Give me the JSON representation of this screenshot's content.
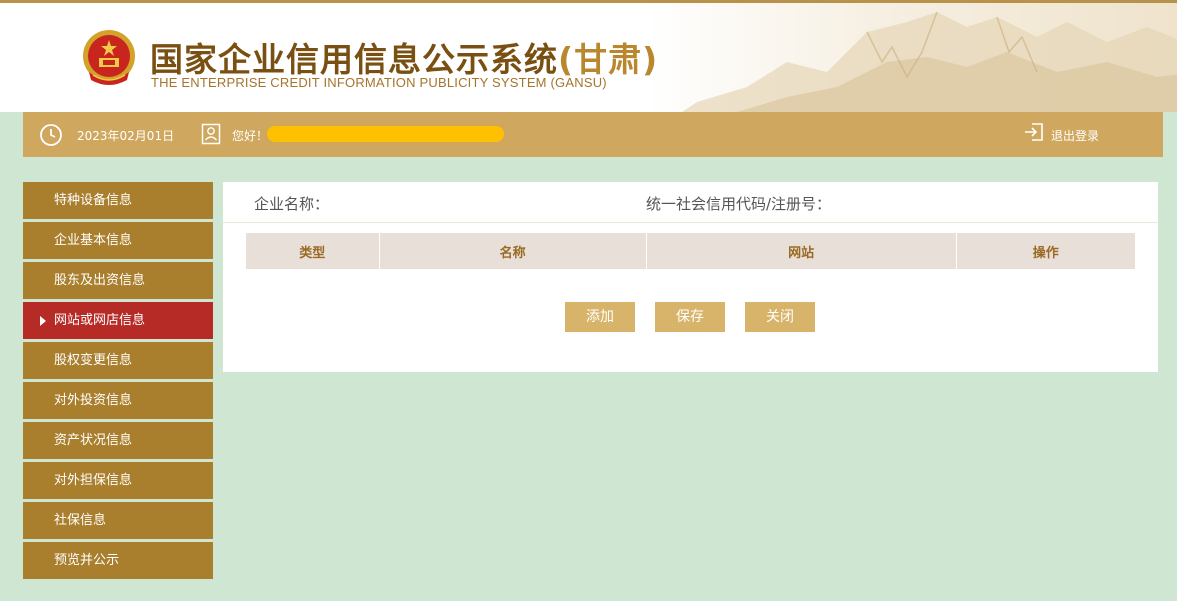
{
  "header": {
    "title_cn": "国家企业信用信息公示系统",
    "title_prov": "(甘肃)",
    "title_en": "THE ENTERPRISE CREDIT INFORMATION PUBLICITY SYSTEM (GANSU)"
  },
  "infobar": {
    "date": "2023年02月01日",
    "greeting": "您好！",
    "logout_label": "退出登录"
  },
  "sidebar": {
    "items": [
      {
        "label": "特种设备信息",
        "active": false
      },
      {
        "label": "企业基本信息",
        "active": false
      },
      {
        "label": "股东及出资信息",
        "active": false
      },
      {
        "label": "网站或网店信息",
        "active": true
      },
      {
        "label": "股权变更信息",
        "active": false
      },
      {
        "label": "对外投资信息",
        "active": false
      },
      {
        "label": "资产状况信息",
        "active": false
      },
      {
        "label": "对外担保信息",
        "active": false
      },
      {
        "label": "社保信息",
        "active": false
      },
      {
        "label": "预览并公示",
        "active": false
      }
    ]
  },
  "panel": {
    "enterprise_name_label": "企业名称：",
    "credit_code_label": "统一社会信用代码/注册号：",
    "table": {
      "columns": [
        "类型",
        "名称",
        "网站",
        "操作"
      ],
      "rows": []
    },
    "buttons": {
      "add": "添加",
      "save": "保存",
      "close": "关闭"
    }
  },
  "colors": {
    "background": "#cfe7d2",
    "infobar": "#cfa75e",
    "sidebar_item": "#a97f2d",
    "sidebar_active": "#b72b27",
    "button": "#d8b46a",
    "title": "#7a4f12"
  }
}
